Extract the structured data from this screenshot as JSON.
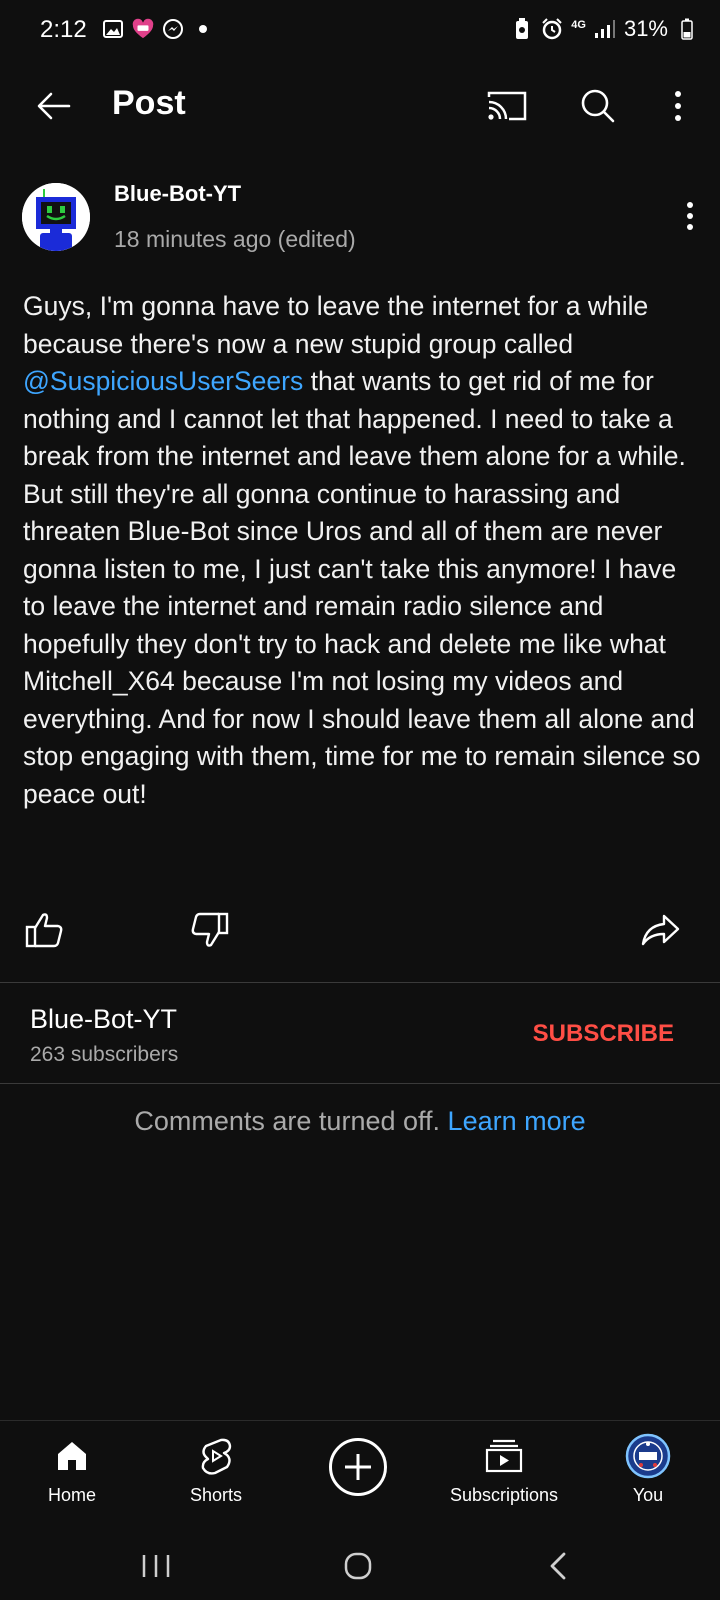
{
  "status_bar": {
    "time": "2:12",
    "network": "4G",
    "battery": "31%",
    "icons_left": [
      "gallery-icon",
      "app-notification-icon",
      "messenger-icon",
      "dot-icon"
    ],
    "icons_right": [
      "battery-saver-icon",
      "alarm-icon",
      "network-4g-icon",
      "signal-icon",
      "battery-icon"
    ]
  },
  "header": {
    "title": "Post",
    "actions": [
      "cast-icon",
      "search-icon",
      "more-vert-icon"
    ]
  },
  "post": {
    "author": "Blue-Bot-YT",
    "time_ago": "18 minutes ago (edited)",
    "text_before": "Guys, I'm gonna have to leave the internet for a while because there's now a new stupid group called ",
    "mention": "@SuspiciousUserSeers",
    "text_after": " that wants to get rid of me for nothing and I cannot let that happened. I need to take a break from the internet and leave them alone for a while. But still they're all gonna continue to harassing and threaten Blue-Bot since Uros and all of them are never gonna listen to me, I just can't take this anymore! I have to leave the internet and remain radio silence and hopefully they don't try to hack and delete me like what Mitchell_X64 because I'm not losing my videos and everything. And for now I should leave them all alone and stop engaging with them, time for me to remain silence so peace out!"
  },
  "channel": {
    "name": "Blue-Bot-YT",
    "subscribers": "263 subscribers",
    "subscribe_label": "SUBSCRIBE"
  },
  "comments": {
    "off_text": "Comments are turned off.",
    "learn_more": "Learn more"
  },
  "bottom_nav": {
    "home": "Home",
    "shorts": "Shorts",
    "subscriptions": "Subscriptions",
    "you": "You"
  },
  "colors": {
    "background": "#0f0f0f",
    "link": "#3ea6ff",
    "subscribe": "#ff4e45",
    "secondary_text": "#aaaaaa"
  }
}
